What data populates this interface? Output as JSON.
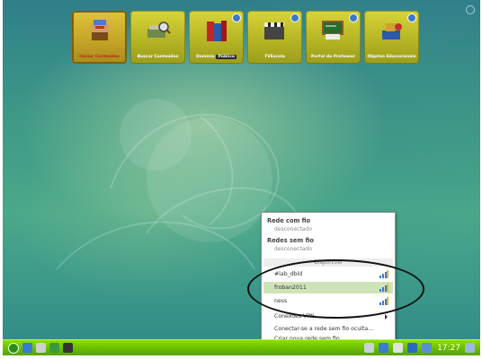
{
  "launchers": [
    {
      "label": "Iniciar Conteúdos",
      "icon": "books-icon",
      "active": true
    },
    {
      "label": "Buscar Conteúdos",
      "icon": "search-books-icon",
      "active": false
    },
    {
      "label_prefix": "Domínio",
      "label_box": "Público",
      "icon": "books-red-blue-icon",
      "active": false
    },
    {
      "label_prefix": "TV",
      "label_suffix": "Escola",
      "icon": "clapperboard-icon",
      "active": false
    },
    {
      "label": "Portal do Professor",
      "icon": "chalkboard-icon",
      "active": false
    },
    {
      "label": "Objetos Educacionais",
      "icon": "education-objects-icon",
      "active": false
    }
  ],
  "network_menu": {
    "wired_title": "Rede com fio",
    "wired_status": "desconectado",
    "wireless_title": "Redes sem fio",
    "wireless_status": "desconectado",
    "available_label": "Disponível",
    "networks": [
      {
        "name": "#lab_dbld",
        "selected": false
      },
      {
        "name": "froban2011",
        "selected": true
      },
      {
        "name": "ness",
        "selected": false
      }
    ],
    "connect_vpn": "Conexões VPN",
    "hidden_network": "Conectar-se a rede sem fio oculta...",
    "new_network": "Criar nova rede sem fio..."
  },
  "taskbar": {
    "clock": "17:27"
  }
}
